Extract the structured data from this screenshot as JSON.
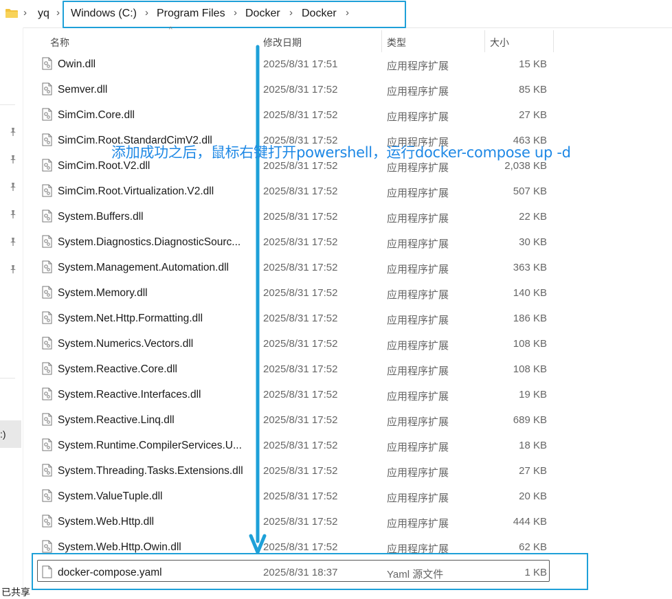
{
  "breadcrumb": {
    "items": [
      "yq",
      "Windows (C:)",
      "Program Files",
      "Docker",
      "Docker"
    ]
  },
  "columns": {
    "name": "名称",
    "date": "修改日期",
    "type": "类型",
    "size": "大小"
  },
  "nav": {
    "selected_label": ":)",
    "bottom_label": "已共享"
  },
  "files": [
    {
      "name": "Owin.dll",
      "date": "2025/8/31 17:51",
      "type": "应用程序扩展",
      "size": "15 KB"
    },
    {
      "name": "Semver.dll",
      "date": "2025/8/31 17:52",
      "type": "应用程序扩展",
      "size": "85 KB"
    },
    {
      "name": "SimCim.Core.dll",
      "date": "2025/8/31 17:52",
      "type": "应用程序扩展",
      "size": "27 KB"
    },
    {
      "name": "SimCim.Root.StandardCimV2.dll",
      "date": "2025/8/31 17:52",
      "type": "应用程序扩展",
      "size": "463 KB"
    },
    {
      "name": "SimCim.Root.V2.dll",
      "date": "2025/8/31 17:52",
      "type": "应用程序扩展",
      "size": "2,038 KB"
    },
    {
      "name": "SimCim.Root.Virtualization.V2.dll",
      "date": "2025/8/31 17:52",
      "type": "应用程序扩展",
      "size": "507 KB"
    },
    {
      "name": "System.Buffers.dll",
      "date": "2025/8/31 17:52",
      "type": "应用程序扩展",
      "size": "22 KB"
    },
    {
      "name": "System.Diagnostics.DiagnosticSourc...",
      "date": "2025/8/31 17:52",
      "type": "应用程序扩展",
      "size": "30 KB"
    },
    {
      "name": "System.Management.Automation.dll",
      "date": "2025/8/31 17:52",
      "type": "应用程序扩展",
      "size": "363 KB"
    },
    {
      "name": "System.Memory.dll",
      "date": "2025/8/31 17:52",
      "type": "应用程序扩展",
      "size": "140 KB"
    },
    {
      "name": "System.Net.Http.Formatting.dll",
      "date": "2025/8/31 17:52",
      "type": "应用程序扩展",
      "size": "186 KB"
    },
    {
      "name": "System.Numerics.Vectors.dll",
      "date": "2025/8/31 17:52",
      "type": "应用程序扩展",
      "size": "108 KB"
    },
    {
      "name": "System.Reactive.Core.dll",
      "date": "2025/8/31 17:52",
      "type": "应用程序扩展",
      "size": "108 KB"
    },
    {
      "name": "System.Reactive.Interfaces.dll",
      "date": "2025/8/31 17:52",
      "type": "应用程序扩展",
      "size": "19 KB"
    },
    {
      "name": "System.Reactive.Linq.dll",
      "date": "2025/8/31 17:52",
      "type": "应用程序扩展",
      "size": "689 KB"
    },
    {
      "name": "System.Runtime.CompilerServices.U...",
      "date": "2025/8/31 17:52",
      "type": "应用程序扩展",
      "size": "18 KB"
    },
    {
      "name": "System.Threading.Tasks.Extensions.dll",
      "date": "2025/8/31 17:52",
      "type": "应用程序扩展",
      "size": "27 KB"
    },
    {
      "name": "System.ValueTuple.dll",
      "date": "2025/8/31 17:52",
      "type": "应用程序扩展",
      "size": "20 KB"
    },
    {
      "name": "System.Web.Http.dll",
      "date": "2025/8/31 17:52",
      "type": "应用程序扩展",
      "size": "444 KB"
    },
    {
      "name": "System.Web.Http.Owin.dll",
      "date": "2025/8/31 17:52",
      "type": "应用程序扩展",
      "size": "62 KB"
    },
    {
      "name": "docker-compose.yaml",
      "date": "2025/8/31 18:37",
      "type": "Yaml 源文件",
      "size": "1 KB",
      "icon": "blank-file-icon"
    }
  ],
  "annotation": {
    "text": "添加成功之后，鼠标右键打开powershell，运行docker-compose up -d"
  },
  "colors": {
    "annotation": "#1e88e5",
    "highlight_box": "#1ea0d8",
    "folder": "#f3c23c"
  }
}
